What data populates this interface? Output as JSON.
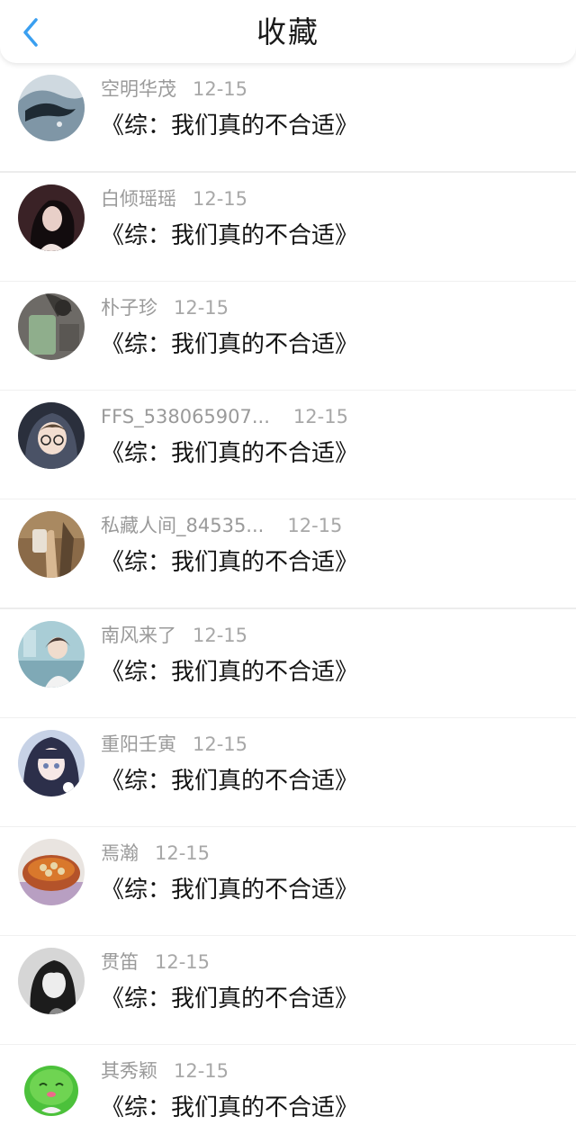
{
  "header": {
    "title": "收藏"
  },
  "items": [
    {
      "name": "空明华茂",
      "date": "12-15",
      "book": "《综：我们真的不合适》"
    },
    {
      "name": "白倾瑶瑶",
      "date": "12-15",
      "book": "《综：我们真的不合适》"
    },
    {
      "name": "朴子珍",
      "date": "12-15",
      "book": "《综：我们真的不合适》"
    },
    {
      "name": "FFS_538065907...",
      "date": "12-15",
      "book": "《综：我们真的不合适》"
    },
    {
      "name": "私藏人间_84535...",
      "date": "12-15",
      "book": "《综：我们真的不合适》"
    },
    {
      "name": "南风来了",
      "date": "12-15",
      "book": "《综：我们真的不合适》"
    },
    {
      "name": "重阳壬寅",
      "date": "12-15",
      "book": "《综：我们真的不合适》"
    },
    {
      "name": "焉瀚",
      "date": "12-15",
      "book": "《综：我们真的不合适》"
    },
    {
      "name": "贯笛",
      "date": "12-15",
      "book": "《综：我们真的不合适》"
    },
    {
      "name": "其秀颖",
      "date": "12-15",
      "book": "《综：我们真的不合适》"
    }
  ],
  "colors": {
    "accent": "#3a9ff0",
    "title_text": "#1a1a1a",
    "meta_text": "#9a9a9a"
  }
}
